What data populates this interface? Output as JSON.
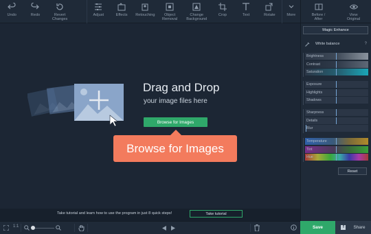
{
  "toolbar": {
    "undo": "Undo",
    "redo": "Redo",
    "revert_line1": "Revert",
    "revert_line2": "Changes",
    "adjust": "Adjust",
    "effects": "Effects",
    "retouching": "Retouching",
    "object_removal_line1": "Object",
    "object_removal_line2": "Removal",
    "change_bg_line1": "Change",
    "change_bg_line2": "Background",
    "crop": "Crop",
    "text": "Text",
    "rotate": "Rotate",
    "more": "More",
    "before_after_line1": "Before /",
    "before_after_line2": "After",
    "view_original_line1": "View",
    "view_original_line2": "Original"
  },
  "canvas": {
    "title": "Drag and Drop",
    "subtitle": "your image files here",
    "browse_small": "Browse for Images",
    "browse_big": "Browse for Images"
  },
  "tutorial": {
    "text": "Take tutorial and learn how to use the program in just 8 quick steps!",
    "button": "Take tutorial"
  },
  "bottombar": {
    "ratio": "1:1"
  },
  "panel": {
    "magic_enhance": "Magic Enhance",
    "white_balance": "White balance",
    "help": "?",
    "groups": [
      [
        "Brightness",
        "Contrast",
        "Saturation"
      ],
      [
        "Exposure",
        "Highlights",
        "Shadows"
      ],
      [
        "Sharpness",
        "Details",
        "Blur"
      ],
      [
        "Temperature",
        "Tint",
        "Hue"
      ]
    ],
    "reset": "Reset"
  },
  "footer": {
    "save": "Save",
    "share": "Share"
  },
  "colors": {
    "accent_green": "#2fa86a",
    "callout_orange": "#f37b5d",
    "saturation_teal": "#1aa6b7"
  }
}
